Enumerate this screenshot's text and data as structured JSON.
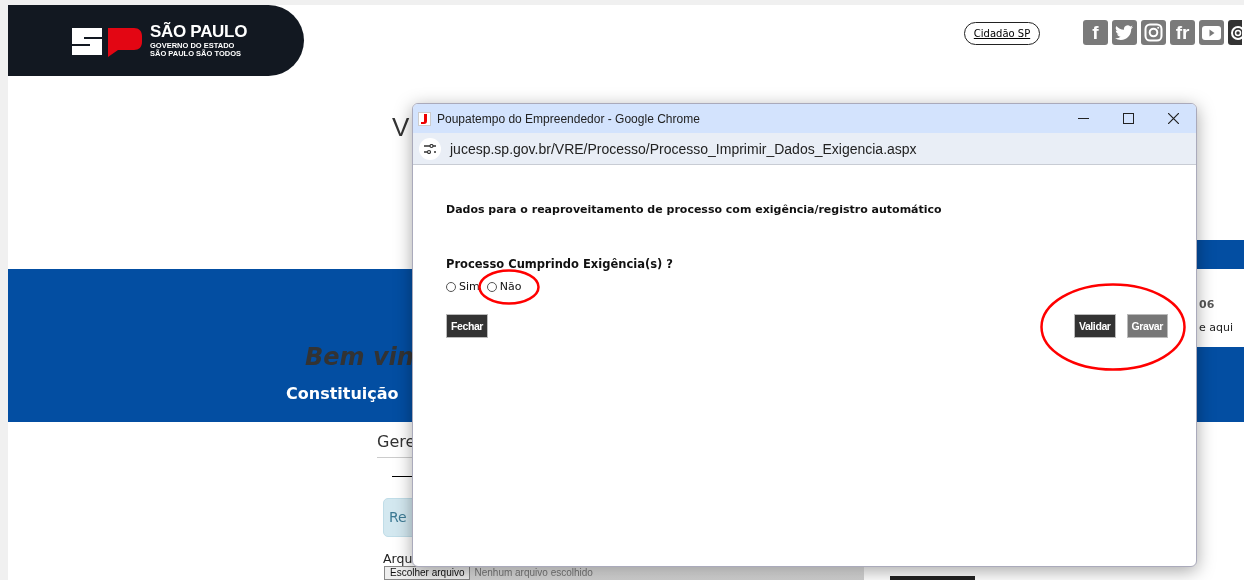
{
  "header": {
    "logo": {
      "title": "SÃO PAULO",
      "subtitle": "GOVERNO DO ESTADO",
      "slogan": "SÃO PAULO SÃO TODOS"
    },
    "citizen_link": "Cidadão SP",
    "social_links": [
      {
        "kind": "letter",
        "label": "f"
      },
      {
        "kind": "bird"
      },
      {
        "kind": "camera"
      },
      {
        "kind": "letter",
        "label": "fr"
      },
      {
        "kind": "play"
      },
      {
        "kind": "ring"
      }
    ]
  },
  "page": {
    "heading": "V",
    "banner_title": "Bem vin",
    "banner_link": "Constituição",
    "side_card": {
      "number": "06",
      "text": "e aqui"
    },
    "tab_label": "Gere",
    "notice": "Re",
    "file_label": "Arqu",
    "file_button": "Escolher arquivo",
    "file_status": "Nenhum arquivo escolhido"
  },
  "popup": {
    "title": "Poupatempo do Empreendedor - Google Chrome",
    "url": "jucesp.sp.gov.br/VRE/Processo/Processo_Imprimir_Dados_Exigencia.aspx",
    "heading": "Dados para o reaproveitamento de processo com exigência/registro automático",
    "question": "Processo Cumprindo Exigência(s) ?",
    "options": [
      {
        "label": "Sim",
        "selected": false,
        "circled": false
      },
      {
        "label": "Não",
        "selected": false,
        "circled": true
      }
    ],
    "buttons_left": [
      {
        "label": "Fechar",
        "disabled": false
      }
    ],
    "buttons_right": {
      "circled": true,
      "items": [
        {
          "label": "Validar",
          "disabled": false
        },
        {
          "label": "Gravar",
          "disabled": true
        }
      ]
    }
  }
}
